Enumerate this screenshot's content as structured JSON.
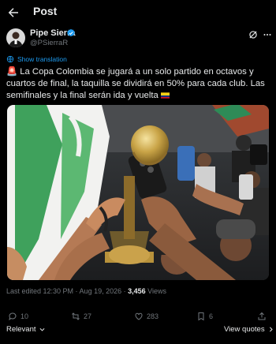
{
  "header": {
    "title": "Post"
  },
  "author": {
    "display_name": "Pipe Sierra",
    "handle": "@PSierraR",
    "verified": true
  },
  "translation": {
    "label": "Show translation"
  },
  "tweet": {
    "text_before_flag": "🚨 La Copa Colombia se jugará a un solo partido en octavos y cuartos de final, la taquilla se dividirá en 50% para cada club. Las semifinales y la final serán ida y vuelta "
  },
  "meta": {
    "edited_prefix": "Last edited 12:30 PM · Aug 19, 2026 · ",
    "views_count": "3,456",
    "views_label": " Views"
  },
  "actions": {
    "replies": "10",
    "reposts": "27",
    "likes": "283",
    "bookmarks": "6"
  },
  "footer": {
    "sort_label": "Relevant",
    "view_quotes": "View quotes"
  },
  "colors": {
    "accent": "#1d9bf0",
    "text": "#e7e9ea",
    "muted": "#71767b",
    "background": "#000000"
  },
  "icons": [
    "back-arrow-icon",
    "verified-badge-icon",
    "grok-icon",
    "more-icon",
    "globe-icon",
    "reply-icon",
    "repost-icon",
    "like-icon",
    "bookmark-icon",
    "share-icon",
    "chevron-down-icon",
    "chevron-right-icon"
  ]
}
